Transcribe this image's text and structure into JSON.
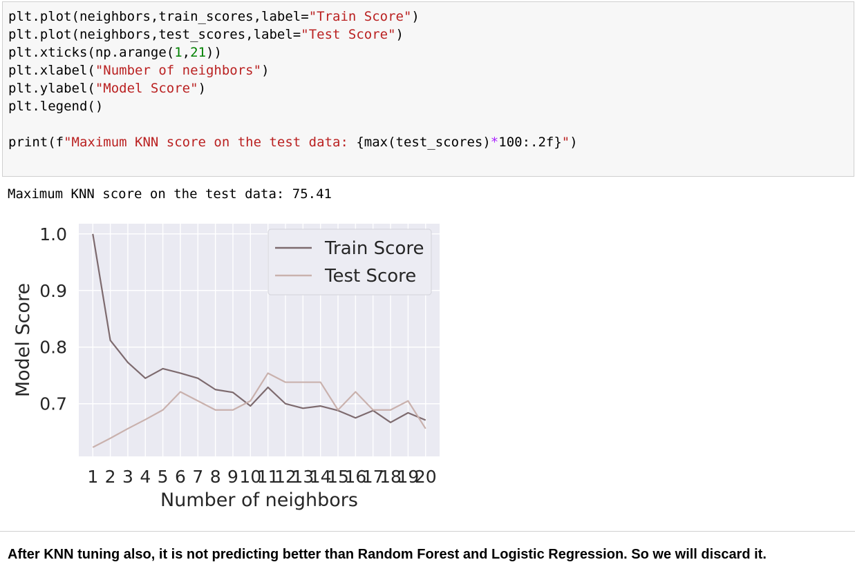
{
  "code_cell": {
    "lines": [
      [
        {
          "t": "plt.plot(neighbors,train_scores,label="
        },
        {
          "t": "\"Train Score\"",
          "c": "str"
        },
        {
          "t": ")"
        }
      ],
      [
        {
          "t": "plt.plot(neighbors,test_scores,label="
        },
        {
          "t": "\"Test Score\"",
          "c": "str"
        },
        {
          "t": ")"
        }
      ],
      [
        {
          "t": "plt.xticks(np.arange("
        },
        {
          "t": "1",
          "c": "num"
        },
        {
          "t": ","
        },
        {
          "t": "21",
          "c": "num"
        },
        {
          "t": "))"
        }
      ],
      [
        {
          "t": "plt.xlabel("
        },
        {
          "t": "\"Number of neighbors\"",
          "c": "str"
        },
        {
          "t": ")"
        }
      ],
      [
        {
          "t": "plt.ylabel("
        },
        {
          "t": "\"Model Score\"",
          "c": "str"
        },
        {
          "t": ")"
        }
      ],
      [
        {
          "t": "plt.legend()"
        }
      ],
      [
        {
          "t": ""
        }
      ],
      [
        {
          "t": "print(f"
        },
        {
          "t": "\"Maximum KNN score on the test data: ",
          "c": "str"
        },
        {
          "t": "{max(test_scores)"
        },
        {
          "t": "*",
          "c": "op"
        },
        {
          "t": "100"
        },
        {
          "t": ":.2f}"
        },
        {
          "t": "\"",
          "c": "str"
        },
        {
          "t": ")"
        }
      ]
    ]
  },
  "output": {
    "text": "Maximum KNN score on the test data: 75.41"
  },
  "chart_data": {
    "type": "line",
    "xlabel": "Number of neighbors",
    "ylabel": "Model Score",
    "x": [
      1,
      2,
      3,
      4,
      5,
      6,
      7,
      8,
      9,
      10,
      11,
      12,
      13,
      14,
      15,
      16,
      17,
      18,
      19,
      20
    ],
    "xticks": [
      "1",
      "2",
      "3",
      "4",
      "5",
      "6",
      "7",
      "8",
      "9",
      "10",
      "11",
      "12",
      "13",
      "14",
      "15",
      "16",
      "17",
      "18",
      "19",
      "20"
    ],
    "yticks": [
      0.7,
      0.8,
      0.9,
      1.0
    ],
    "ytick_labels": [
      "0.7",
      "0.8",
      "0.9",
      "1.0"
    ],
    "xlim": [
      0.2,
      20.8
    ],
    "ylim": [
      0.607,
      1.018
    ],
    "grid": true,
    "legend_position": "top-right",
    "series": [
      {
        "name": "Train Score",
        "color": "#7d6a6e",
        "values": [
          1.0,
          0.812,
          0.773,
          0.745,
          0.762,
          0.754,
          0.745,
          0.725,
          0.72,
          0.696,
          0.729,
          0.7,
          0.692,
          0.696,
          0.688,
          0.675,
          0.688,
          0.667,
          0.684,
          0.671
        ]
      },
      {
        "name": "Test Score",
        "color": "#c9b1ad",
        "values": [
          0.623,
          0.639,
          0.656,
          0.672,
          0.689,
          0.721,
          0.705,
          0.689,
          0.689,
          0.705,
          0.754,
          0.738,
          0.738,
          0.738,
          0.689,
          0.721,
          0.689,
          0.689,
          0.705,
          0.656
        ]
      }
    ],
    "bg_color": "#eaeaf2",
    "grid_color": "#ffffff"
  },
  "markdown": {
    "text": "After KNN tuning also, it is not predicting better than Random Forest and Logistic Regression. So we will discard it."
  }
}
